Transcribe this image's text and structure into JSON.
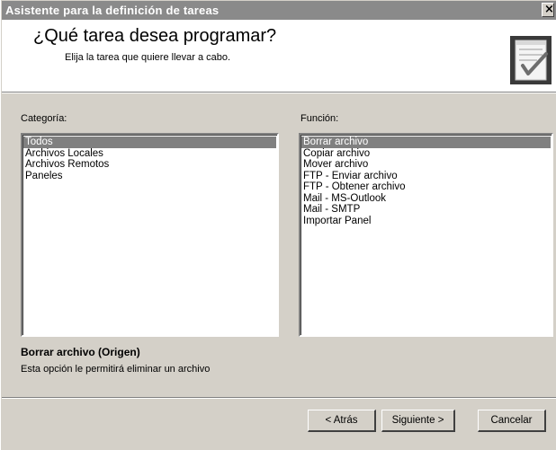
{
  "window": {
    "title": "Asistente para la definición de tareas",
    "close_glyph": "×"
  },
  "header": {
    "title": "¿Qué tarea desea programar?",
    "subtitle": "Elija la tarea que quiere llevar a cabo.",
    "icon": "checklist-icon"
  },
  "categoria": {
    "label": "Categoría:",
    "items": [
      {
        "label": "Todos",
        "selected": true
      },
      {
        "label": "Archivos Locales",
        "selected": false
      },
      {
        "label": "Archivos Remotos",
        "selected": false
      },
      {
        "label": "Paneles",
        "selected": false
      }
    ]
  },
  "funcion": {
    "label": "Función:",
    "items": [
      {
        "label": "Borrar archivo",
        "selected": true
      },
      {
        "label": "Copiar archivo",
        "selected": false
      },
      {
        "label": "Mover archivo",
        "selected": false
      },
      {
        "label": "FTP - Enviar archivo",
        "selected": false
      },
      {
        "label": "FTP - Obtener archivo",
        "selected": false
      },
      {
        "label": "Mail - MS-Outlook",
        "selected": false
      },
      {
        "label": "Mail - SMTP",
        "selected": false
      },
      {
        "label": "Importar Panel",
        "selected": false
      }
    ]
  },
  "description": {
    "title": "Borrar archivo (Origen)",
    "text": "Esta opción le permitirá eliminar un archivo"
  },
  "buttons": {
    "back": "< Atrás",
    "next": "Siguiente >",
    "cancel": "Cancelar"
  },
  "colors": {
    "title_bar": "#8a8a8a",
    "dialog_face": "#d4d0c8",
    "selection": "#808080"
  }
}
